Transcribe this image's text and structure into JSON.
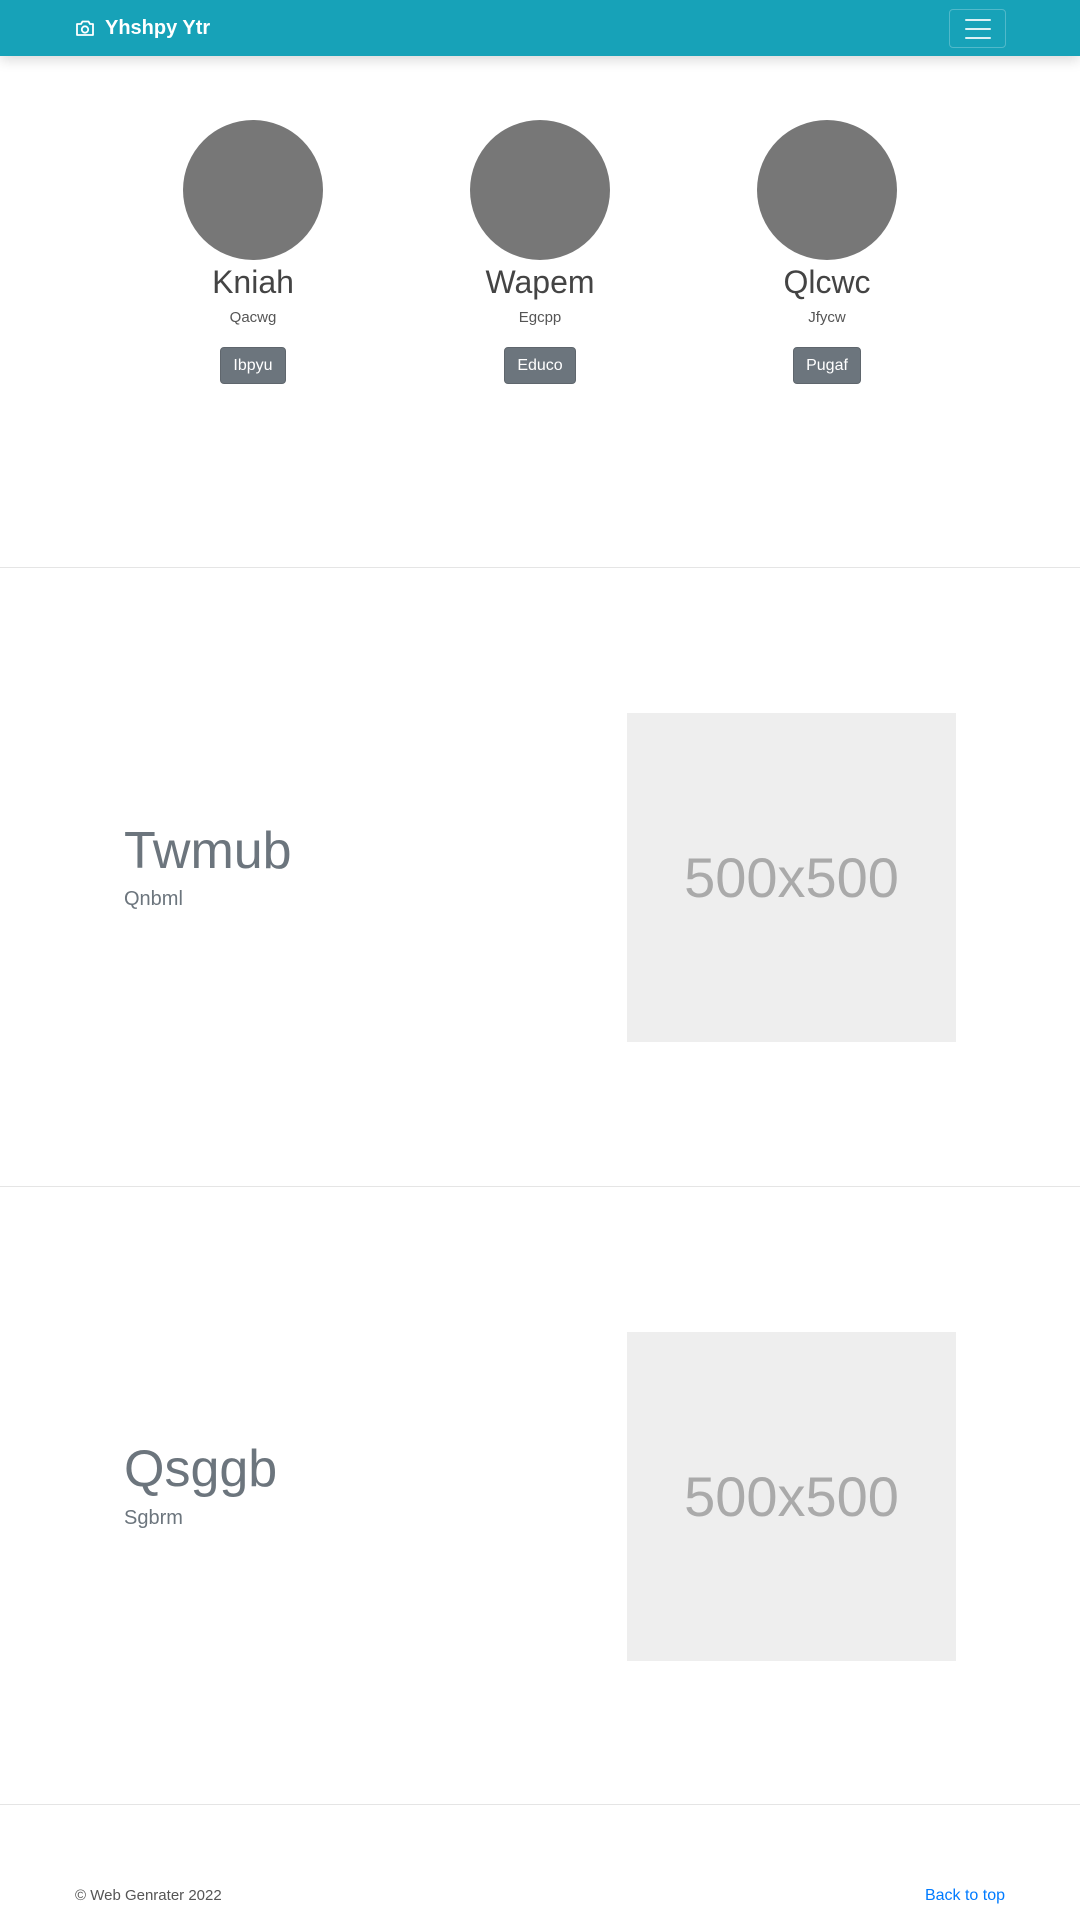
{
  "navbar": {
    "brand": "Yhshpy Ytr",
    "brand_icon": "camera-icon",
    "toggler_icon": "hamburger-menu-icon",
    "color": "#17a2b8"
  },
  "team": [
    {
      "name": "Kniah",
      "role": "Qacwg",
      "button": "Ibpyu"
    },
    {
      "name": "Wapem",
      "role": "Egcpp",
      "button": "Educo"
    },
    {
      "name": "Qlcwc",
      "role": "Jfycw",
      "button": "Pugaf"
    }
  ],
  "features": [
    {
      "title": "Twmub",
      "subtitle": "Qnbml",
      "image_text": "500x500"
    },
    {
      "title": "Qsggb",
      "subtitle": "Sgbrm",
      "image_text": "500x500"
    }
  ],
  "footer": {
    "copyright": "© Web Genrater 2022",
    "back_to_top": "Back to top"
  }
}
